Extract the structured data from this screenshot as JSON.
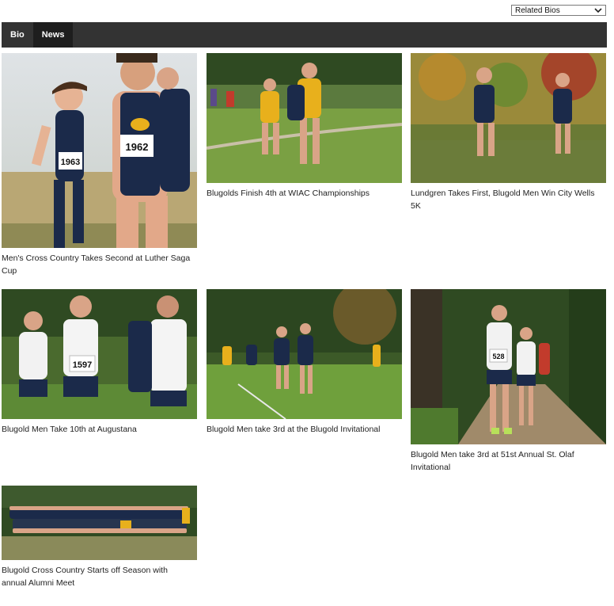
{
  "related_bios": {
    "selected": "Related Bios"
  },
  "tabs": [
    {
      "label": "Bio",
      "active": false
    },
    {
      "label": "News",
      "active": true
    }
  ],
  "news": [
    {
      "headline": "Men's Cross Country Takes Second at Luther Saga Cup",
      "bib_numbers": [
        "1963",
        "1962"
      ]
    },
    {
      "headline": "Blugolds Finish 4th at WIAC Championships"
    },
    {
      "headline": "Lundgren Takes First, Blugold Men Win City Wells 5K"
    },
    {
      "headline": "Blugold Men Take 10th at Augustana",
      "bib_numbers": [
        "1597"
      ]
    },
    {
      "headline": "Blugold Men take 3rd at the Blugold Invitational"
    },
    {
      "headline": "Blugold Men take 3rd at 51st Annual St. Olaf Invitational",
      "bib_numbers": [
        "528"
      ]
    },
    {
      "headline": "Blugold Cross Country Starts off Season with annual Alumni Meet"
    }
  ],
  "colors": {
    "tabbar": "#333333",
    "tab_active": "#1e1e1e",
    "uniform_navy": "#1b2a4a",
    "uniform_gold": "#e8b01c",
    "grass": "#7aa043"
  }
}
